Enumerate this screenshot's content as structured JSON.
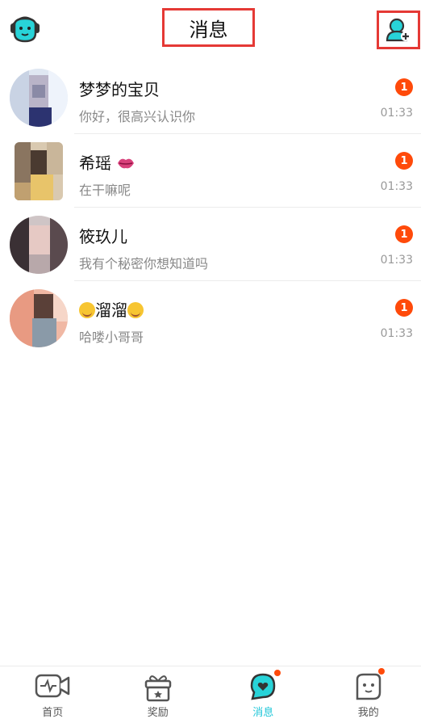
{
  "header": {
    "title": "消息"
  },
  "conversations": [
    {
      "name": "梦梦的宝贝",
      "message": "你好，很高兴认识你",
      "time": "01:33",
      "unread": "1"
    },
    {
      "name": "希瑶",
      "message": "在干嘛呢",
      "time": "01:33",
      "unread": "1"
    },
    {
      "name": "筱玖儿",
      "message": "我有个秘密你想知道吗",
      "time": "01:33",
      "unread": "1"
    },
    {
      "name": "溜溜",
      "message": "哈喽小哥哥",
      "time": "01:33",
      "unread": "1"
    }
  ],
  "tabs": [
    {
      "label": "首页",
      "icon": "video-chat-icon"
    },
    {
      "label": "奖励",
      "icon": "gift-icon"
    },
    {
      "label": "消息",
      "icon": "message-heart-icon",
      "active": true
    },
    {
      "label": "我的",
      "icon": "profile-face-icon"
    }
  ],
  "colors": {
    "accent": "#1ec6d8",
    "badge": "#ff4a0a",
    "highlight_box": "#e53935"
  }
}
